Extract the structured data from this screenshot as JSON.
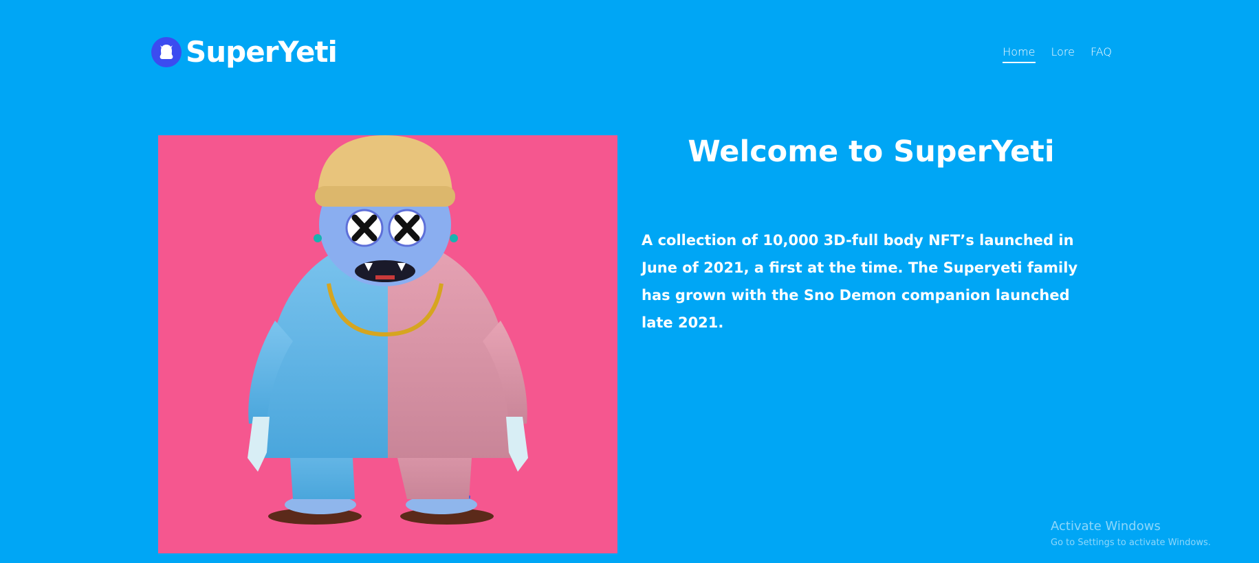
{
  "header": {
    "brand": "SuperYeti",
    "nav": [
      {
        "label": "Home",
        "active": true
      },
      {
        "label": "Lore",
        "active": false
      },
      {
        "label": "FAQ",
        "active": false
      }
    ]
  },
  "hero": {
    "image_icon": "yeti-character-illustration",
    "background_color": "#f5578f"
  },
  "main": {
    "title": "Welcome to SuperYeti",
    "description": "A collection of 10,000 3D-full body NFT’s launched in June of 2021, a first at the time. The Superyeti family has grown with the Sno Demon companion launched late 2021."
  },
  "watermark": {
    "title": "Activate Windows",
    "subtitle": "Go to Settings to activate Windows."
  },
  "colors": {
    "page_background": "#00a6f5",
    "logo_badge": "#3b4cf0",
    "text": "#ffffff"
  }
}
